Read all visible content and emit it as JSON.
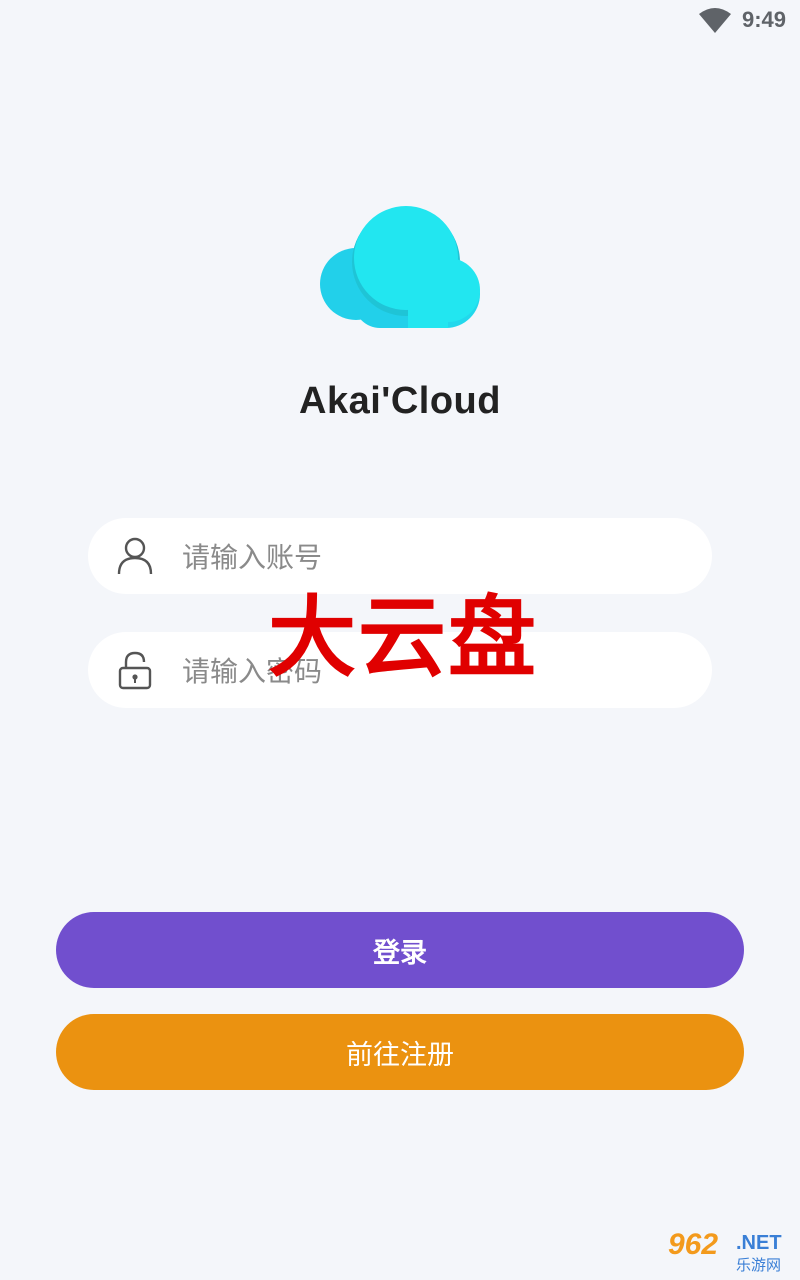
{
  "status_bar": {
    "time": "9:49",
    "wifi_icon": "wifi-icon"
  },
  "app": {
    "name": "Akai'Cloud",
    "logo_icon": "cloud-logo-icon"
  },
  "login_form": {
    "account": {
      "placeholder": "请输入账号",
      "value": "",
      "icon": "user-icon"
    },
    "password": {
      "placeholder": "请输入密码",
      "value": "",
      "icon": "lock-icon"
    }
  },
  "buttons": {
    "login_label": "登录",
    "register_label": "前往注册"
  },
  "overlay": {
    "watermark_text": "大云盘",
    "site_logo_number": "962",
    "site_logo_net": ".NET",
    "site_logo_cn": "乐游网"
  },
  "colors": {
    "background": "#f4f6fa",
    "login_button": "#714fce",
    "register_button": "#eb9210",
    "cloud_light": "#22e6f0",
    "cloud_dark": "#22d0ea",
    "watermark": "#e00000"
  }
}
